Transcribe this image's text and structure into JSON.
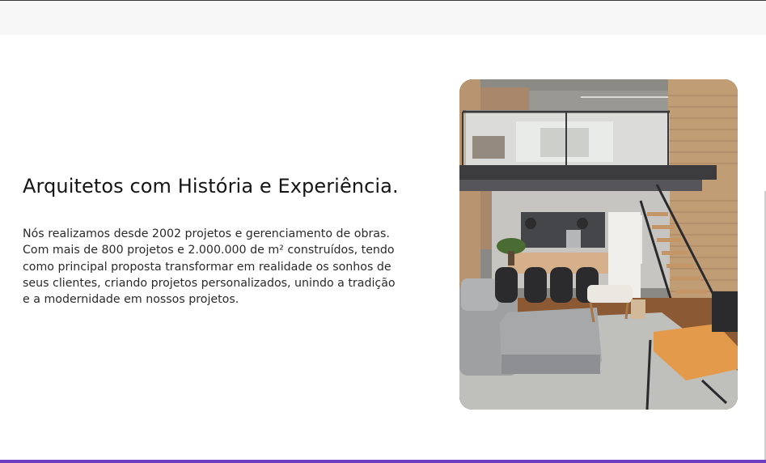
{
  "section": {
    "title": "Arquitetos com História e Experiência.",
    "paragraph_lines": [
      "Nós realizamos desde 2002 projetos e gerenciamento de obras.",
      "Com mais de 800 projetos e 2.000.000 de m² construídos, tendo",
      "como principal proposta transformar em realidade os sonhos de",
      "seus clientes, criando projetos personalizados, unindo a tradição",
      "e a modernidade em nossos projetos."
    ]
  },
  "colors": {
    "accent_bar": "#6c3fc2",
    "header_bg": "#f7f7f7",
    "text": "#1a1a1a"
  }
}
